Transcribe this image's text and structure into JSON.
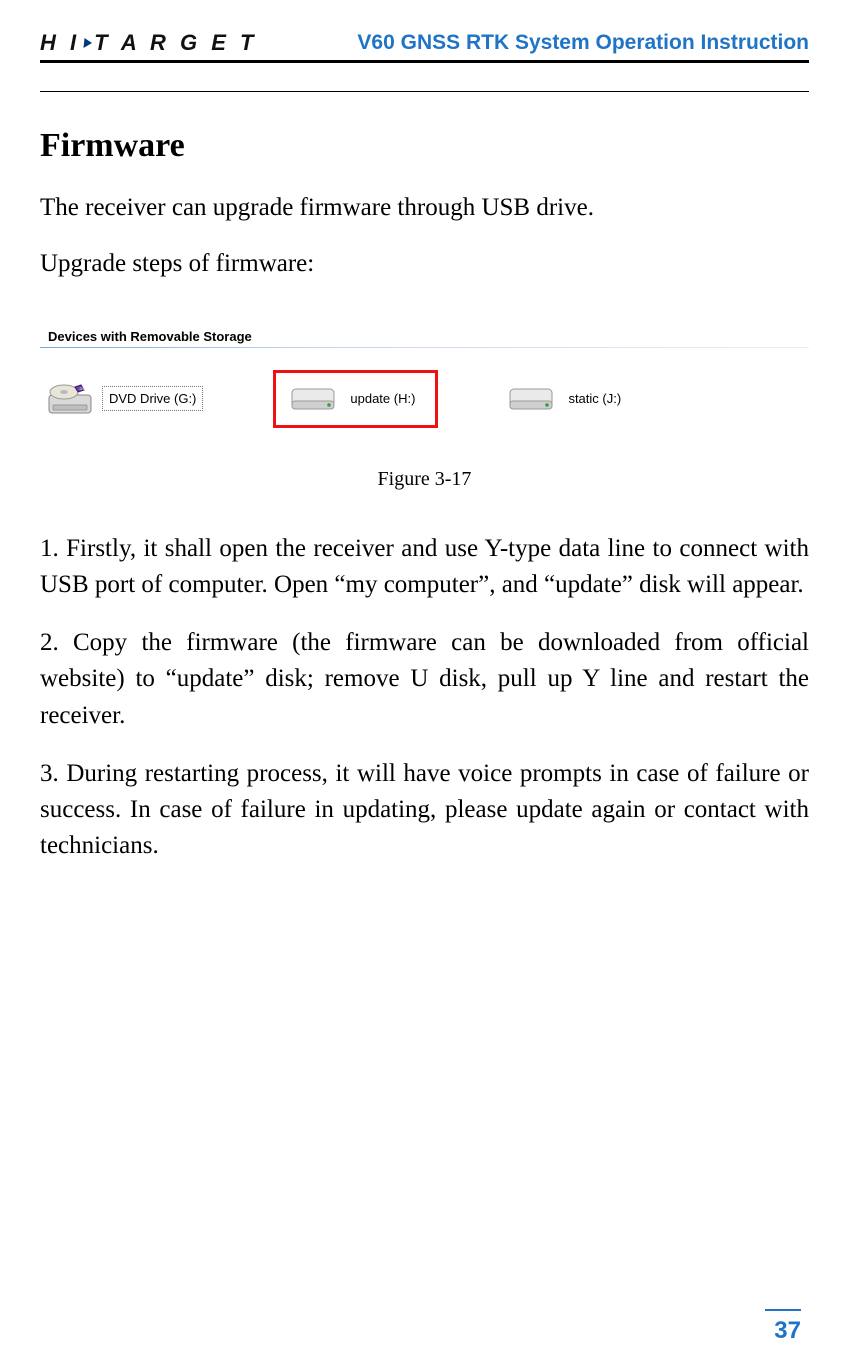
{
  "header": {
    "logo_part1": "H I",
    "logo_part2": "T A R G E T",
    "doc_title": "V60 GNSS RTK System Operation Instruction"
  },
  "section_title": "Firmware",
  "intro1": "The receiver can upgrade firmware through USB drive.",
  "intro2": "Upgrade steps of firmware:",
  "figure": {
    "group_header": "Devices with Removable Storage",
    "device1_label": "DVD Drive (G:)",
    "device2_label": "update (H:)",
    "device3_label": "static (J:)",
    "caption": "Figure 3-17"
  },
  "steps": {
    "s1": "1. Firstly, it shall open the receiver and use Y-type data line to connect with USB port of computer. Open “my computer”, and “update” disk will appear.",
    "s2": "2. Copy the firmware (the firmware can be downloaded from official website) to “update” disk; remove U disk, pull up Y line and restart the receiver.",
    "s3": "3. During restarting process, it will have voice prompts in case of failure or success. In case of failure in updating, please update again or contact with technicians."
  },
  "page_number": "37"
}
